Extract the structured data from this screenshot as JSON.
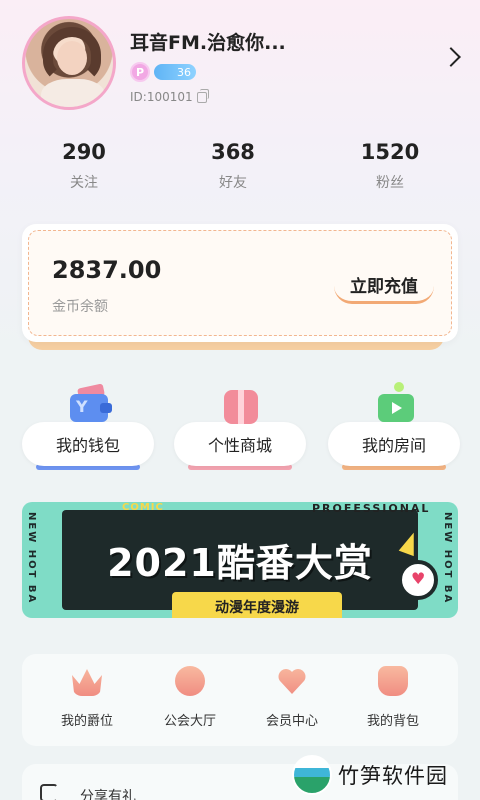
{
  "profile": {
    "name": "耳音FM.治愈你...",
    "badge_p": "P",
    "level": "36",
    "id_text": "ID:100101"
  },
  "stats": [
    {
      "value": "290",
      "label": "关注"
    },
    {
      "value": "368",
      "label": "好友"
    },
    {
      "value": "1520",
      "label": "粉丝"
    }
  ],
  "wallet": {
    "balance": "2837.00",
    "balance_label": "金币余额",
    "recharge_label": "立即充值"
  },
  "features": [
    {
      "label": "我的钱包",
      "icon": "wallet-icon",
      "underline": "#6f95f2"
    },
    {
      "label": "个性商城",
      "icon": "gift-icon",
      "underline": "#f3a3b0"
    },
    {
      "label": "我的房间",
      "icon": "tv-room-icon",
      "underline": "#f2b383"
    }
  ],
  "banner": {
    "title": "2021酷番大赏",
    "subtitle": "动漫年度漫游",
    "tag_top": "PROFESSIONAL",
    "tag_comic": "COMIC",
    "side_text": "NEW HOT BA"
  },
  "menu": [
    {
      "label": "我的爵位",
      "icon": "crown-icon"
    },
    {
      "label": "公会大厅",
      "icon": "guild-icon"
    },
    {
      "label": "会员中心",
      "icon": "heart-icon"
    },
    {
      "label": "我的背包",
      "icon": "bag-icon"
    }
  ],
  "share": {
    "label": "分享有礼"
  },
  "watermark": {
    "text": "竹笋软件园"
  },
  "colors": {
    "accent": "#f2a975",
    "pink": "#f4a7c9",
    "banner_bg": "#7fdcc6"
  }
}
